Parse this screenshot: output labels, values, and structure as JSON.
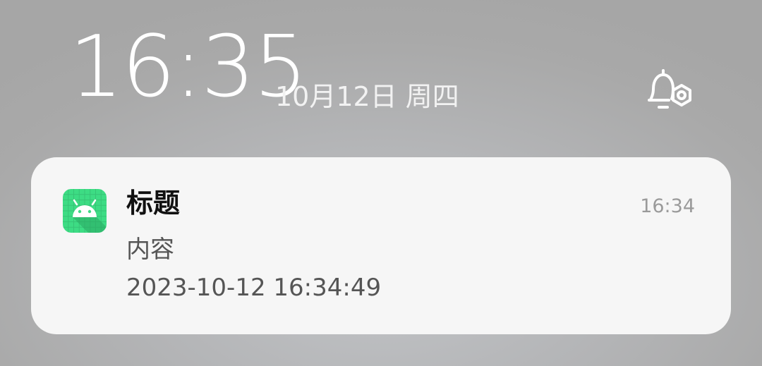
{
  "lockscreen": {
    "time": "16:35",
    "date": "10月12日 周四",
    "notification_settings_icon": "bell-settings-icon"
  },
  "notification": {
    "app_icon": "android-app-icon",
    "title": "标题",
    "time": "16:34",
    "body": "内容",
    "timestamp": "2023-10-12 16:34:49"
  },
  "colors": {
    "background": "#aaaaaa",
    "card": "#f6f6f6",
    "app_icon_green": "#3ddc84",
    "clock_text": "#ffffff",
    "title_text": "#111111",
    "secondary_text": "#555555",
    "time_text": "#9a9a9a"
  }
}
